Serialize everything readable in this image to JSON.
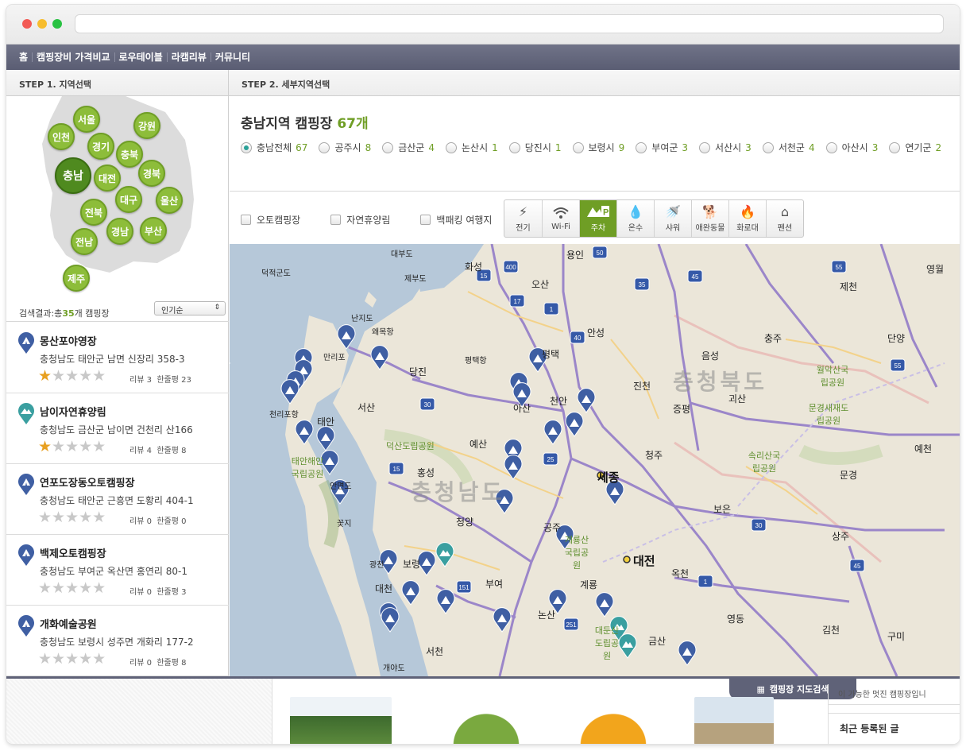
{
  "topnav": [
    "홈",
    "캠핑장비 가격비교",
    "로우테이블",
    "라캠리뷰",
    "커뮤니티"
  ],
  "steps": {
    "step1": "STEP 1. 지역선택",
    "step2": "STEP 2. 세부지역선택"
  },
  "regions": [
    "서울",
    "인천",
    "강원",
    "경기",
    "충북",
    "충남",
    "대전",
    "경북",
    "대구",
    "울산",
    "전북",
    "경남",
    "부산",
    "전남",
    "제주"
  ],
  "result": {
    "prefix": "검색결과:총",
    "count": "35",
    "suffix": "개 캠핑장",
    "sort": "인기순"
  },
  "campsites": [
    {
      "title": "몽산포야영장",
      "addr": "충청남도 태안군 남면 신장리 358-3",
      "review": "리뷰 3",
      "oneline": "한줄평 23",
      "rating": 0.5,
      "pin": "blue"
    },
    {
      "title": "남이자연휴양림",
      "addr": "충청남도 금산군 남이면 건천리 산166",
      "review": "리뷰 4",
      "oneline": "한줄평 8",
      "rating": 0.5,
      "pin": "teal"
    },
    {
      "title": "연포도장동오토캠핑장",
      "addr": "충청남도 태안군 근흥면 도황리 404-1",
      "review": "리뷰 0",
      "oneline": "한줄평 0",
      "rating": 0,
      "pin": "blue"
    },
    {
      "title": "백제오토캠핑장",
      "addr": "충청남도 부여군 옥산면 홍연리 80-1",
      "review": "리뷰 0",
      "oneline": "한줄평 3",
      "rating": 0,
      "pin": "blue"
    },
    {
      "title": "개화예술공원",
      "addr": "충청남도 보령시 성주면 개화리 177-2",
      "review": "리뷰 0",
      "oneline": "한줄평 8",
      "rating": 0,
      "pin": "blue"
    }
  ],
  "region_title": {
    "text": "충남지역 캠핑장",
    "count": "67개"
  },
  "subregions": [
    {
      "name": "충남전체",
      "n": "67",
      "on": true
    },
    {
      "name": "공주시",
      "n": "8"
    },
    {
      "name": "금산군",
      "n": "4"
    },
    {
      "name": "논산시",
      "n": "1"
    },
    {
      "name": "당진시",
      "n": "1"
    },
    {
      "name": "보령시",
      "n": "9"
    },
    {
      "name": "부여군",
      "n": "3"
    },
    {
      "name": "서산시",
      "n": "3"
    },
    {
      "name": "서천군",
      "n": "4"
    },
    {
      "name": "아산시",
      "n": "3"
    },
    {
      "name": "연기군",
      "n": "2"
    }
  ],
  "types": [
    "오토캠핑장",
    "자연휴양림",
    "백패킹 여행지"
  ],
  "amenities": [
    {
      "label": "전기",
      "icon": "bolt-icon"
    },
    {
      "label": "Wi-Fi",
      "icon": "wifi-icon"
    },
    {
      "label": "주차",
      "icon": "parking-icon",
      "on": true
    },
    {
      "label": "온수",
      "icon": "drop-icon"
    },
    {
      "label": "샤워",
      "icon": "shower-icon"
    },
    {
      "label": "애완동물",
      "icon": "dog-icon"
    },
    {
      "label": "화로대",
      "icon": "fire-icon"
    },
    {
      "label": "펜션",
      "icon": "house-icon"
    }
  ],
  "map_labels": [
    "충청남도",
    "충청북도",
    "세종",
    "대전",
    "당진",
    "서산",
    "태안",
    "홍성",
    "예산",
    "청양",
    "공주",
    "보령",
    "부여",
    "논산",
    "계룡",
    "서천",
    "대천",
    "천안",
    "아산",
    "평택",
    "안성",
    "용인",
    "화성",
    "오산",
    "진천",
    "청주",
    "증평",
    "괴산",
    "음성",
    "충주",
    "제천",
    "단양",
    "영월",
    "문경",
    "상주",
    "김천",
    "구미",
    "영동",
    "옥천",
    "보은",
    "금산",
    "예천",
    "덕산도립공원",
    "태안해안국립공원",
    "계룡산국립공원",
    "월악산국립공원",
    "문경새재도립공원",
    "속리산국립공원",
    "대둔산도립공원",
    "난지도",
    "왜목항",
    "평택항",
    "천리포항",
    "제부도",
    "대부도",
    "꽃지",
    "만리포",
    "덕적군도",
    "개야도",
    "광천",
    "안면도",
    "1",
    "15",
    "17",
    "25",
    "30",
    "35",
    "40",
    "45",
    "50",
    "55",
    "151",
    "251",
    "400"
  ],
  "bottom": {
    "map_search": "캠핑장 지도검색",
    "ticker": "이 가능한 멋진 캠핑장입니",
    "recent": "최근 등록된 글"
  },
  "colors": {
    "accent": "#6f9e25",
    "nav": "#5f6278",
    "pin_blue": "#3f5fa3",
    "pin_teal": "#3a9fa0"
  }
}
